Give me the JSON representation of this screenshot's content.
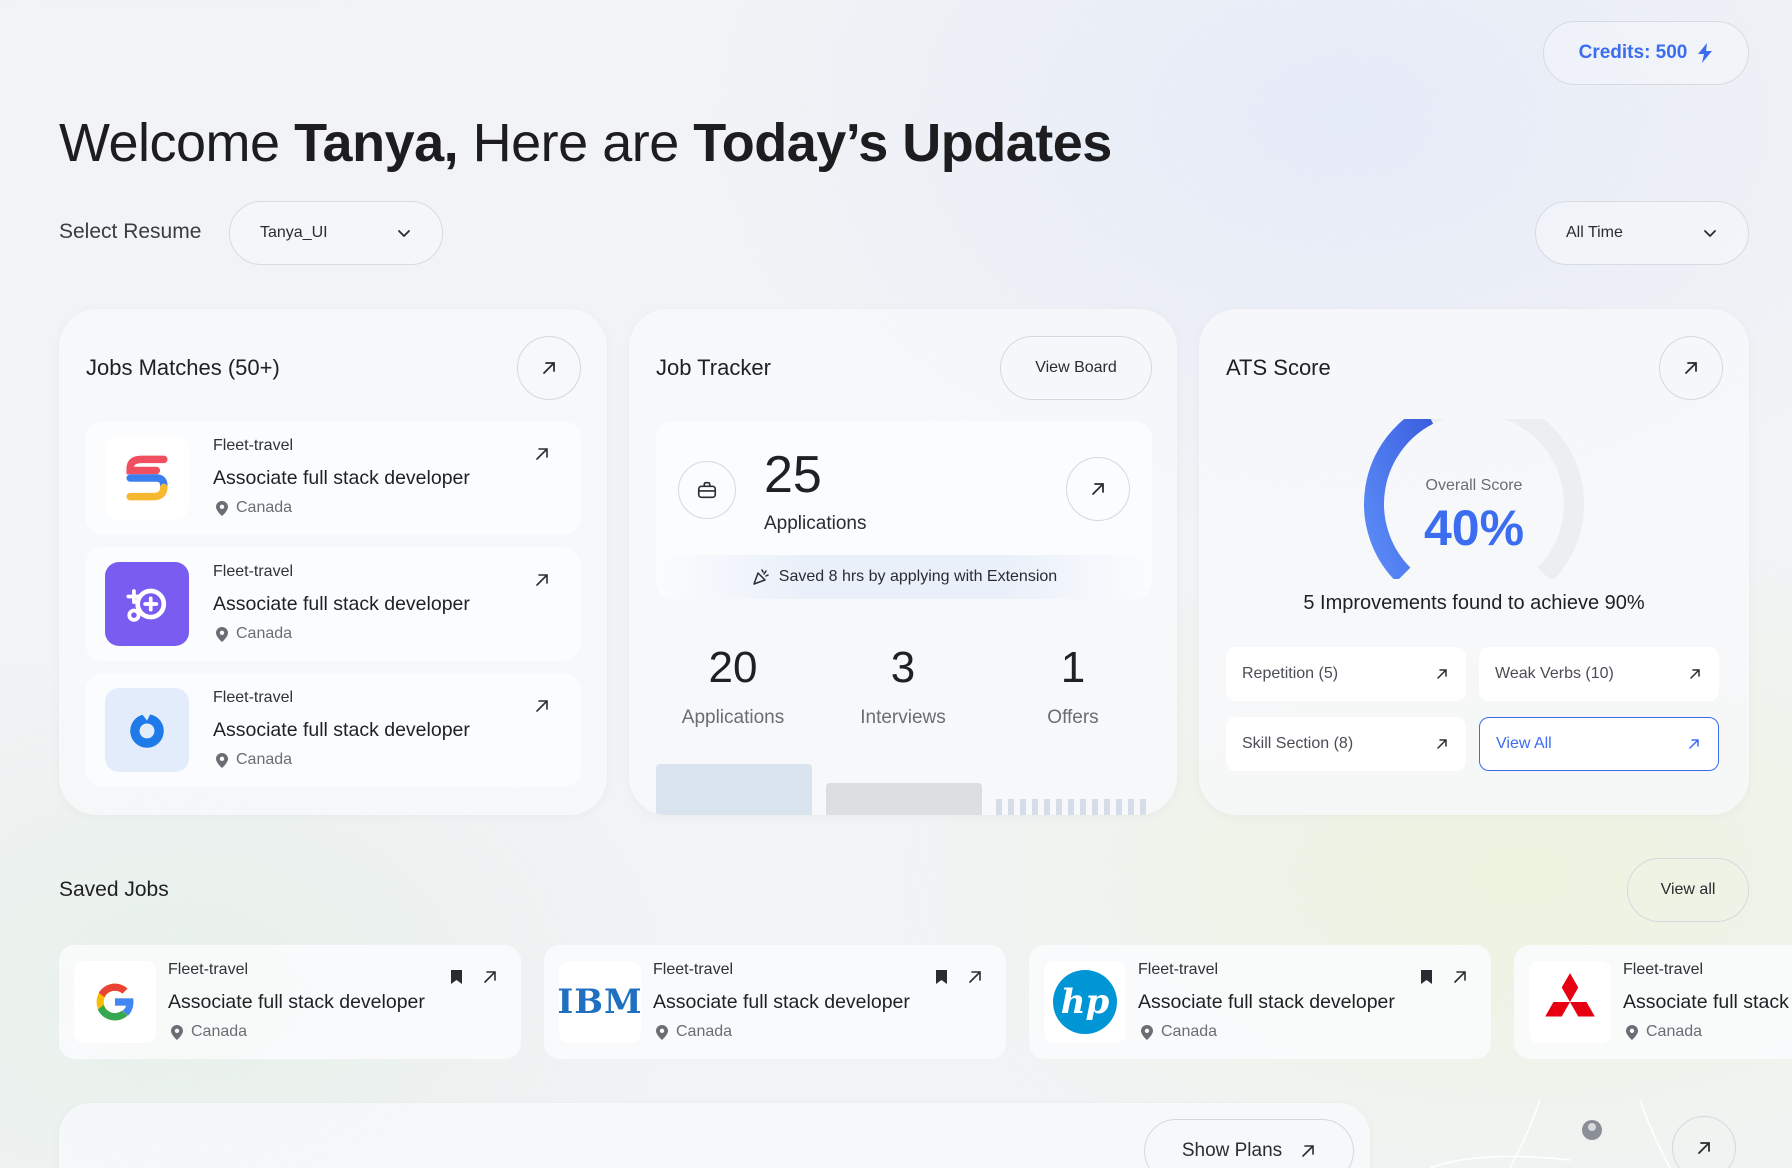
{
  "header": {
    "credits_label": "Credits: 500",
    "welcome_prefix": "Welcome ",
    "welcome_name": "Tanya,",
    "welcome_middle": " Here are ",
    "welcome_bold": "Today’s Updates"
  },
  "filters": {
    "select_resume_label": "Select Resume",
    "resume_value": "Tanya_UI",
    "time_value": "All Time"
  },
  "job_matches": {
    "title": "Jobs Matches (50+)",
    "items": [
      {
        "company": "Fleet-travel",
        "role": "Associate full stack developer",
        "location": "Canada",
        "logo": "multicolor-s-logo"
      },
      {
        "company": "Fleet-travel",
        "role": "Associate full stack developer",
        "location": "Canada",
        "logo": "gamepad-logo"
      },
      {
        "company": "Fleet-travel",
        "role": "Associate full stack developer",
        "location": "Canada",
        "logo": "blue-circle-logo"
      }
    ]
  },
  "job_tracker": {
    "title": "Job Tracker",
    "view_board_label": "View Board",
    "total_applications": "25",
    "total_applications_label": "Applications",
    "saved_note": "Saved 8 hrs by applying with Extension",
    "stats": [
      {
        "value": "20",
        "label": "Applications"
      },
      {
        "value": "3",
        "label": "Interviews"
      },
      {
        "value": "1",
        "label": "Offers"
      }
    ]
  },
  "ats": {
    "title": "ATS Score",
    "overall_label": "Overall Score",
    "score_text": "40%",
    "score_fraction": 0.4,
    "improvements_text": "5 Improvements found to achieve 90%",
    "chips": [
      {
        "label": "Repetition (5)"
      },
      {
        "label": "Weak Verbs (10)"
      },
      {
        "label": "Skill Section (8)"
      },
      {
        "label": "View All"
      }
    ]
  },
  "saved_jobs": {
    "title": "Saved Jobs",
    "view_all_label": "View all",
    "items": [
      {
        "company": "Fleet-travel",
        "role": "Associate full stack developer",
        "location": "Canada",
        "logo": "google-logo"
      },
      {
        "company": "Fleet-travel",
        "role": "Associate full stack developer",
        "location": "Canada",
        "logo": "ibm-logo",
        "logo_text": "IBM"
      },
      {
        "company": "Fleet-travel",
        "role": "Associate full stack developer",
        "location": "Canada",
        "logo": "hp-logo",
        "logo_text": "hp"
      },
      {
        "company": "Fleet-travel",
        "role": "Associate full stack",
        "location": "Canada",
        "logo": "mitsubishi-logo"
      }
    ]
  },
  "bottom": {
    "show_plans_label": "Show Plans"
  },
  "colors": {
    "accent": "#3c6cf0",
    "purple": "#7a5cf0",
    "gauge_track": "#eceef1"
  }
}
